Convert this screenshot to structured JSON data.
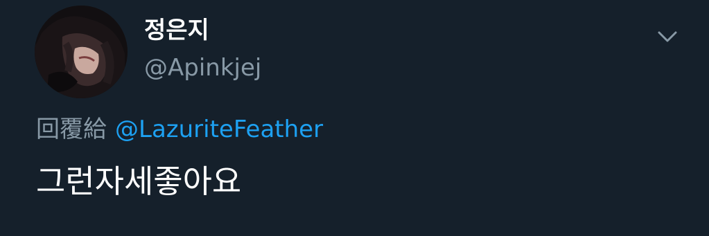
{
  "tweet": {
    "author": {
      "display_name": "정은지",
      "handle": "@Apinkjej"
    },
    "reply": {
      "prefix": "回覆給",
      "target": "@LazuriteFeather"
    },
    "text": "그런자세좋아요",
    "menu_icon": "chevron-down-icon"
  },
  "colors": {
    "background": "#15202b",
    "primary_text": "#ffffff",
    "secondary_text": "#8899a6",
    "link": "#1da1f2"
  }
}
